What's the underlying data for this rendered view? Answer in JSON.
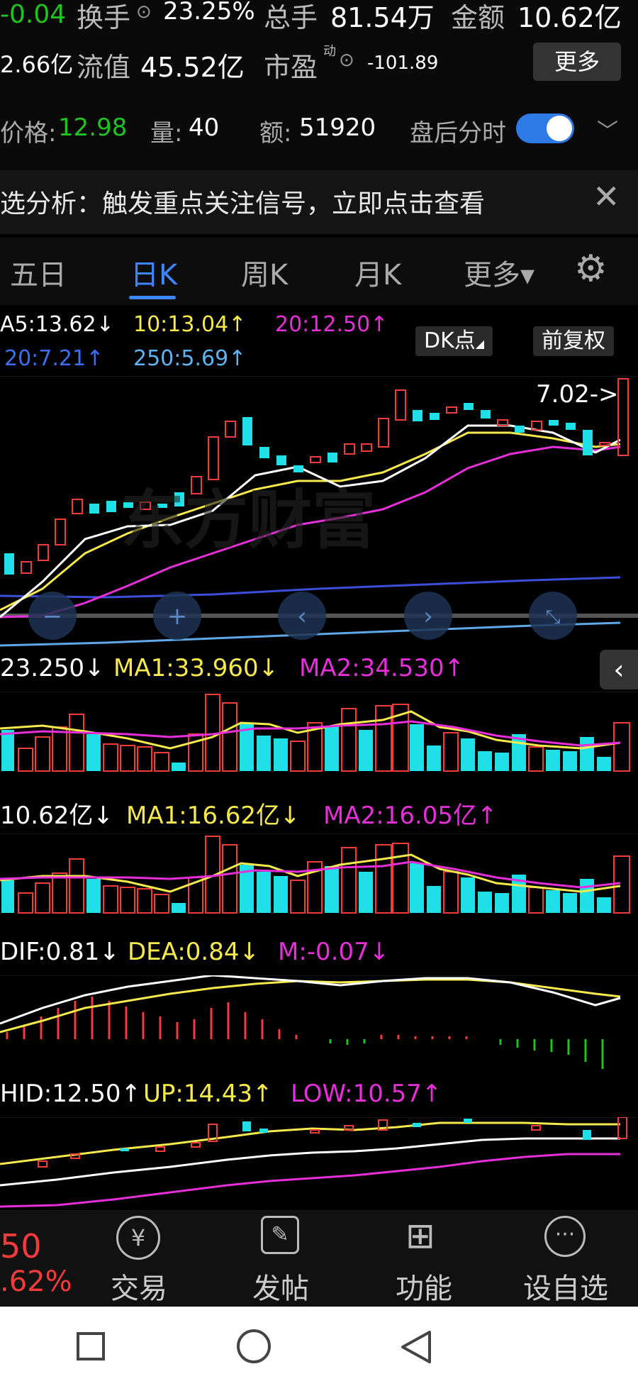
{
  "quote": {
    "change": "-0.04",
    "turnover_label": "换手",
    "turnover_value": "23.25%",
    "total_hands_label": "总手",
    "total_hands_value": "81.54万",
    "amount_label": "金额",
    "amount_value": "10.62亿",
    "mktcap_value": "2.66亿",
    "float_label": "流值",
    "float_value": "45.52亿",
    "pe_label": "市盈",
    "pe_sup": "动",
    "pe_value": "-101.89",
    "more_button": "更多",
    "afterhours_price_label": "价格:",
    "afterhours_price_value": "12.98",
    "afterhours_vol_label": "量:",
    "afterhours_vol_value": "40",
    "afterhours_amt_label": "额:",
    "afterhours_amt_value": "51920",
    "afterhours_toggle_label": "盘后分时",
    "afterhours_toggle_on": true
  },
  "banner": {
    "text": "选分析：触发重点关注信号，立即点击查看"
  },
  "tabs": [
    {
      "label": "五日",
      "active": false
    },
    {
      "label": "日K",
      "active": true
    },
    {
      "label": "周K",
      "active": false
    },
    {
      "label": "月K",
      "active": false
    },
    {
      "label": "更多▾",
      "active": false
    }
  ],
  "ma_legend": {
    "ma5": "A5:13.62↓",
    "ma10": "10:13.04↑",
    "ma20": "20:12.50↑",
    "ma120": "20:7.21↑",
    "ma250": "250:5.69↑",
    "dk_button": "DK点",
    "adjust_button": "前复权",
    "price_marker": "7.02->",
    "watermark": "东方财富",
    "colors": {
      "ma5": "#ffffff",
      "ma10": "#f6e94c",
      "ma20": "#e62fd8",
      "ma120": "#3c4fd8",
      "ma250": "#5fa8e8"
    }
  },
  "vol_panel": {
    "value": "23.250↓",
    "ma1": "MA1:33.960↓",
    "ma2": "MA2:34.530↑"
  },
  "amount_panel": {
    "value": "10.62亿↓",
    "ma1": "MA1:16.62亿↓",
    "ma2": "MA2:16.05亿↑"
  },
  "macd_panel": {
    "dif": "DIF:0.81↓",
    "dea": "DEA:0.84↓",
    "m": "M:-0.07↓"
  },
  "boll_panel": {
    "mid": "HID:12.50↑",
    "up": "UP:14.43↑",
    "low": "LOW:10.57↑"
  },
  "bottom_nav": {
    "price": "50",
    "pct": ".62%",
    "trade": "交易",
    "post": "发帖",
    "func": "功能",
    "watchlist": "设自选"
  },
  "colors": {
    "up": "#f23b3b",
    "down": "#1fe0e6",
    "accent": "#3d86ff"
  }
}
